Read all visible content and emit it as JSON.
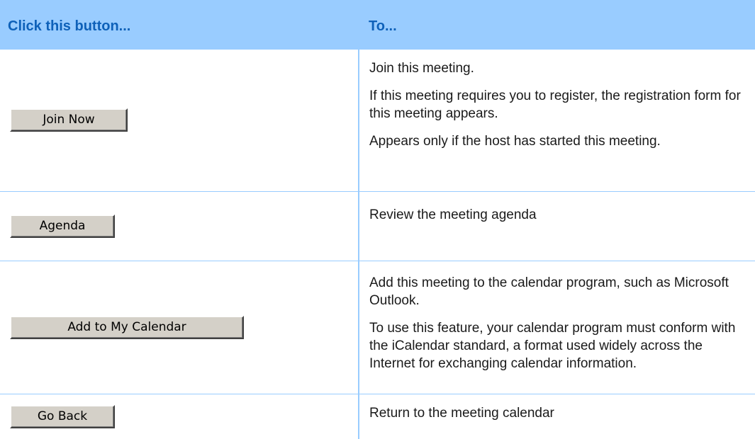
{
  "table": {
    "headers": {
      "col1": "Click this button...",
      "col2": "To..."
    },
    "rows": [
      {
        "button_label": "Join Now",
        "descriptions": [
          "Join this meeting.",
          "If this meeting requires you to register, the registration form for this meeting appears.",
          "Appears only if the host has started this meeting."
        ]
      },
      {
        "button_label": "Agenda",
        "descriptions": [
          "Review the meeting agenda"
        ]
      },
      {
        "button_label": "Add to My Calendar",
        "descriptions": [
          "Add this meeting to the calendar program, such as Microsoft Outlook.",
          "To use this feature, your calendar program must conform with the iCalendar standard, a format used widely across the Internet for exchanging calendar information."
        ]
      },
      {
        "button_label": "Go Back",
        "descriptions": [
          "Return to the meeting calendar"
        ]
      }
    ]
  },
  "colors": {
    "header_background": "#99ccff",
    "header_text": "#0e61b9",
    "button_face": "#d4d0c8",
    "rule": "#99ccff"
  }
}
